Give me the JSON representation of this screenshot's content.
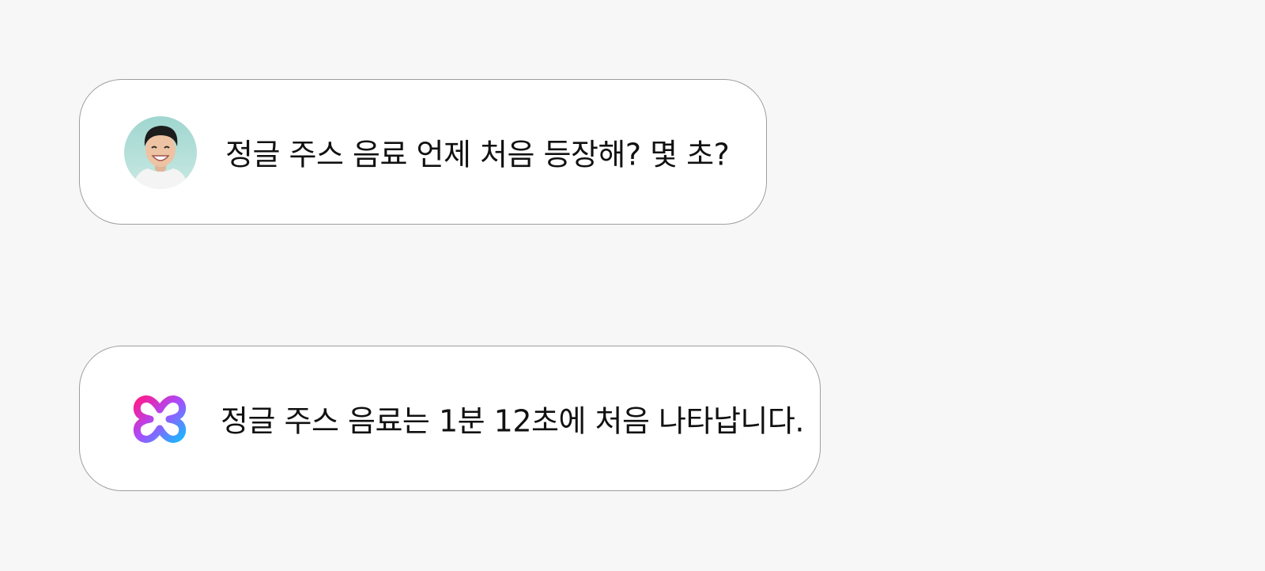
{
  "conversation": {
    "messages": [
      {
        "role": "user",
        "avatar_icon": "user-avatar-photo",
        "text": "정글 주스 음료 언제 처음 등장해? 몇 초?"
      },
      {
        "role": "assistant",
        "avatar_icon": "assistant-logo-icon",
        "text": "정글 주스 음료는 1분 12초에 처음 나타납니다."
      }
    ]
  },
  "colors": {
    "background": "#f7f7f7",
    "bubble": "#ffffff",
    "bubble_border": "#9e9e9e",
    "text": "#111111",
    "logo_gradient_start": "#ff1a8c",
    "logo_gradient_mid": "#a64dff",
    "logo_gradient_end": "#1ab8ff"
  }
}
